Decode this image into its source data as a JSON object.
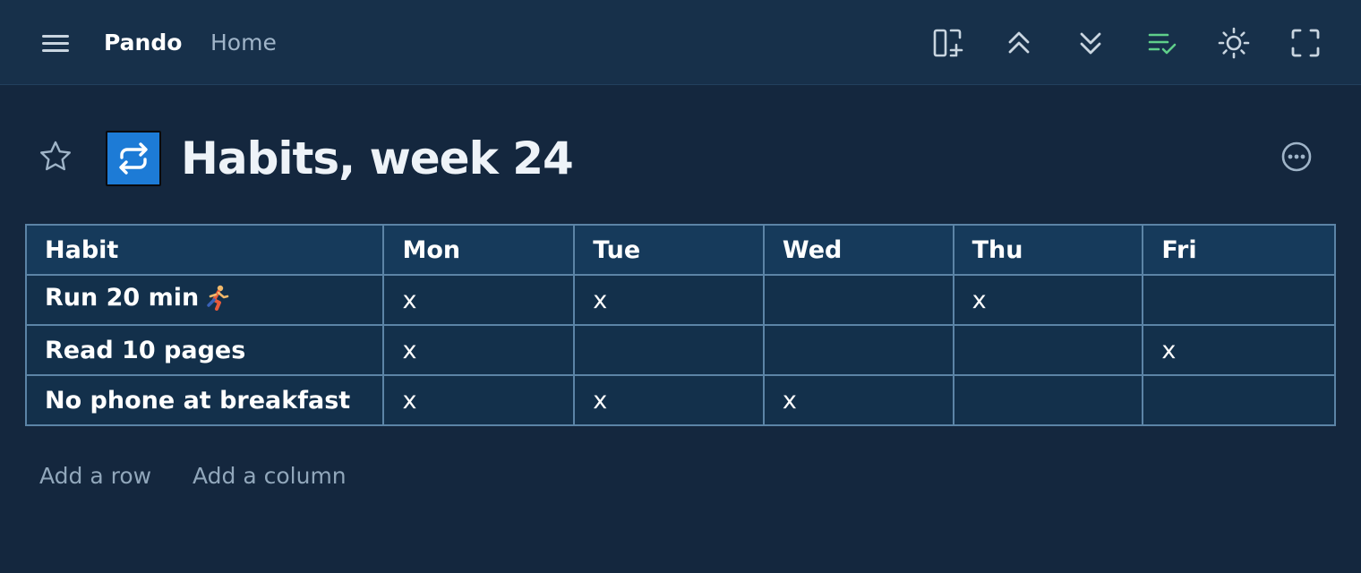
{
  "topbar": {
    "app_name": "Pando",
    "breadcrumb": "Home",
    "icons": [
      "menu-icon",
      "add-page-icon",
      "collapse-up-icon",
      "expand-down-icon",
      "checklist-icon",
      "sun-icon",
      "fullscreen-icon"
    ],
    "accent_checklist": "#5fcf8a"
  },
  "page": {
    "title": "Habits, week 24",
    "icon": "repeat-icon",
    "icon_bg": "#1d7bd6"
  },
  "table": {
    "headers": [
      "Habit",
      "Mon",
      "Tue",
      "Wed",
      "Thu",
      "Fri"
    ],
    "rows": [
      {
        "habit": "Run 20 min",
        "emoji": "runner",
        "cells": [
          "x",
          "x",
          "",
          "x",
          ""
        ]
      },
      {
        "habit": "Read 10 pages",
        "cells": [
          "x",
          "",
          "",
          "",
          "x"
        ]
      },
      {
        "habit": "No phone at breakfast",
        "cells": [
          "x",
          "x",
          "x",
          "",
          ""
        ]
      }
    ]
  },
  "actions": {
    "add_row": "Add a row",
    "add_column": "Add a column"
  },
  "colors": {
    "background": "#14273e",
    "topbar": "#17304a",
    "table_border": "#5c84a6",
    "header_bg": "#163a5b"
  }
}
